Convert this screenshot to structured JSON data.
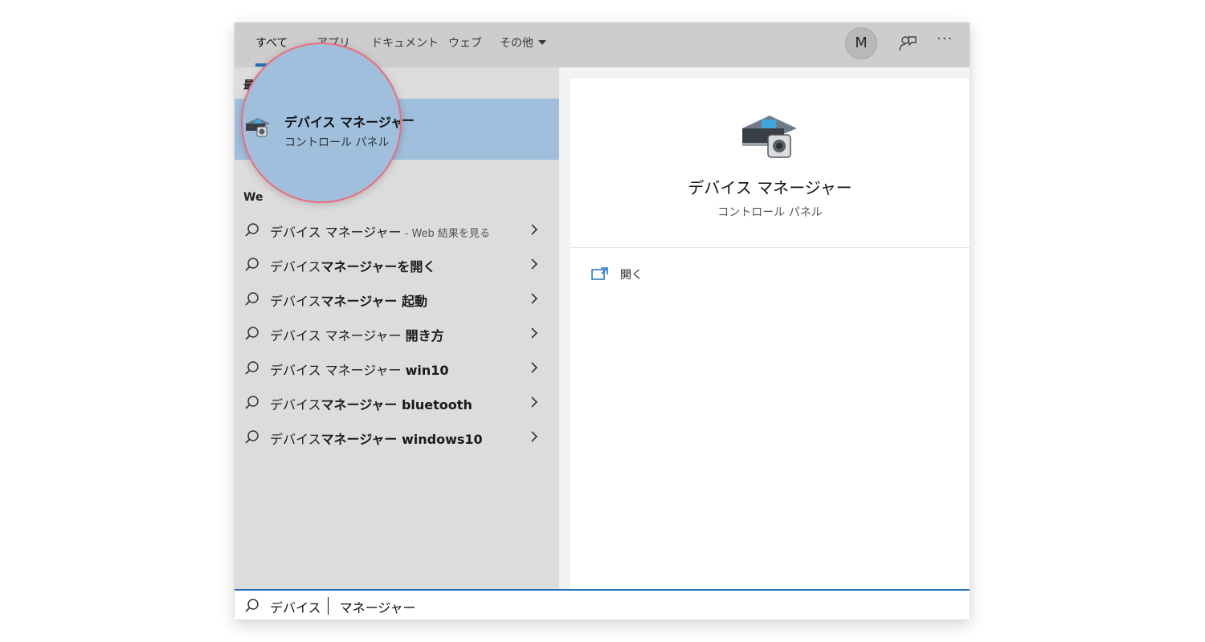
{
  "tabs": [
    {
      "label": "すべて",
      "active": true
    },
    {
      "label": "アプリ",
      "active": false
    },
    {
      "label": "ドキュメント",
      "active": false
    },
    {
      "label": "ウェブ",
      "active": false
    },
    {
      "label": "その他",
      "active": false,
      "dropdown": true
    }
  ],
  "header": {
    "avatar_letter": "M",
    "feedback_icon": "feedback-icon",
    "more_icon": "ellipsis-icon",
    "more_text": "···"
  },
  "left": {
    "best_match_label": "最",
    "web_label": "We",
    "best_match": {
      "title": "デバイス マネージャー",
      "subtitle": "コントロール パネル",
      "icon": "device-manager-icon"
    },
    "suggestions": [
      {
        "prefix": "デバイス マネージャー",
        "bold": "",
        "hint": " - Web 結果を見る"
      },
      {
        "prefix": "デバイス",
        "bold": "マネージャーを開く",
        "hint": ""
      },
      {
        "prefix": "デバイス",
        "bold": "マネージャー 起動",
        "hint": ""
      },
      {
        "prefix": "デバイス マネージャー ",
        "bold": "開き方",
        "hint": ""
      },
      {
        "prefix": "デバイス マネージャー ",
        "bold": "win10",
        "hint": ""
      },
      {
        "prefix": "デバイス",
        "bold": "マネージャー bluetooth",
        "hint": ""
      },
      {
        "prefix": "デバイス",
        "bold": "マネージャー windows10",
        "hint": ""
      }
    ]
  },
  "detail": {
    "title": "デバイス マネージャー",
    "subtitle": "コントロール パネル",
    "icon": "device-manager-icon",
    "actions": [
      {
        "label": "開く",
        "icon": "open-icon"
      }
    ]
  },
  "search": {
    "value_before_caret": "デバイス ",
    "value_after_caret": "マネージャー",
    "icon": "search-icon"
  },
  "colors": {
    "accent": "#1f6fc0",
    "selection": "#9fbfdc",
    "lens_border": "#ee6b7c"
  }
}
